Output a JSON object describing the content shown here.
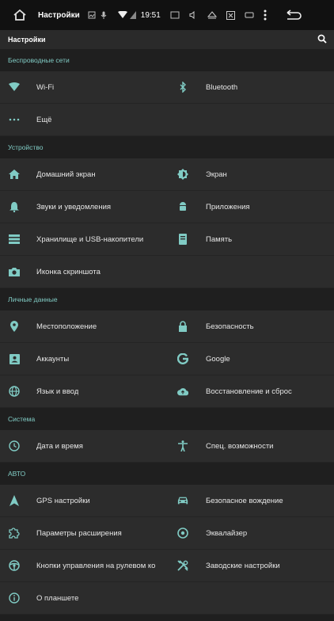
{
  "statusbar": {
    "title": "Настройки",
    "time": "19:51"
  },
  "appbar": {
    "title": "Настройки"
  },
  "sections": [
    {
      "header": "Беспроводные сети",
      "rows": [
        [
          {
            "label": "Wi-Fi",
            "icon": "wifi-icon"
          },
          {
            "label": "Bluetooth",
            "icon": "bluetooth-icon"
          }
        ],
        [
          {
            "label": "Ещё",
            "icon": "more-dots-icon"
          },
          null
        ]
      ]
    },
    {
      "header": "Устройство",
      "rows": [
        [
          {
            "label": "Домашний экран",
            "icon": "home-icon"
          },
          {
            "label": "Экран",
            "icon": "brightness-icon"
          }
        ],
        [
          {
            "label": "Звуки и уведомления",
            "icon": "bell-icon"
          },
          {
            "label": "Приложения",
            "icon": "android-icon"
          }
        ],
        [
          {
            "label": "Хранилище и USB-накопители",
            "icon": "storage-icon"
          },
          {
            "label": "Память",
            "icon": "memory-icon"
          }
        ],
        [
          {
            "label": "Иконка скриншота",
            "icon": "camera-icon"
          },
          null
        ]
      ]
    },
    {
      "header": "Личные данные",
      "rows": [
        [
          {
            "label": "Местоположение",
            "icon": "location-pin-icon"
          },
          {
            "label": "Безопасность",
            "icon": "lock-icon"
          }
        ],
        [
          {
            "label": "Аккаунты",
            "icon": "account-icon"
          },
          {
            "label": "Google",
            "icon": "google-icon"
          }
        ],
        [
          {
            "label": "Язык и ввод",
            "icon": "globe-icon"
          },
          {
            "label": "Восстановление и сброс",
            "icon": "cloud-upload-icon"
          }
        ]
      ]
    },
    {
      "header": "Система",
      "rows": [
        [
          {
            "label": "Дата и время",
            "icon": "clock-icon"
          },
          {
            "label": "Спец. возможности",
            "icon": "accessibility-icon"
          }
        ]
      ]
    },
    {
      "header": "АВТО",
      "rows": [
        [
          {
            "label": "GPS настройки",
            "icon": "navigation-icon"
          },
          {
            "label": "Безопасное вождение",
            "icon": "car-icon"
          }
        ],
        [
          {
            "label": "Параметры расширения",
            "icon": "extension-icon"
          },
          {
            "label": "Эквалайзер",
            "icon": "equalizer-icon"
          }
        ],
        [
          {
            "label": "Кнопки управления на рулевом ко",
            "icon": "steering-wheel-icon"
          },
          {
            "label": "Заводские настройки",
            "icon": "tools-icon"
          }
        ],
        [
          {
            "label": "О планшете",
            "icon": "info-icon"
          },
          null
        ]
      ]
    }
  ]
}
